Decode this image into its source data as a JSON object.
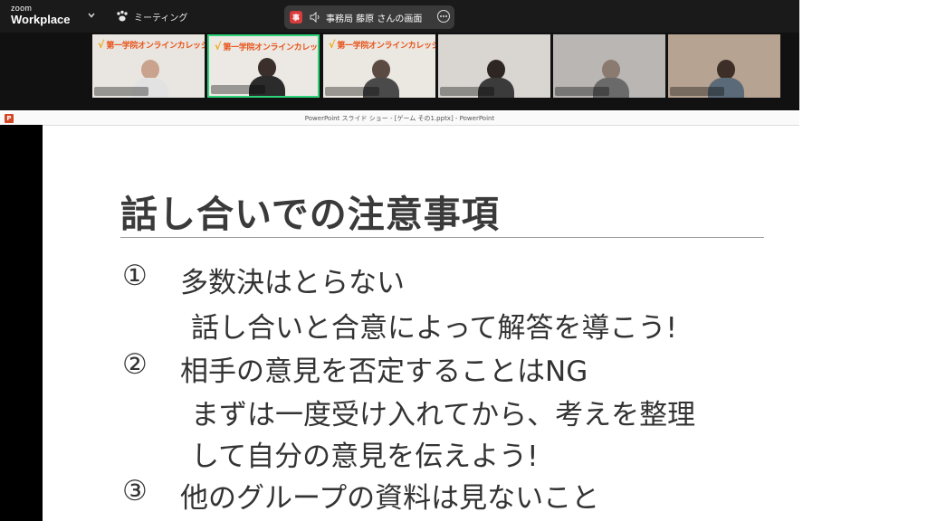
{
  "app": {
    "brand_small": "zoom",
    "brand_main": "Workplace",
    "meeting_label": "ミーティング",
    "share_badge": "事",
    "share_text": "事務局 藤原 さんの画面",
    "colors": {
      "active_border": "#2fd37a",
      "share_badge": "#d83b3b",
      "logo_orange": "#e8541a"
    }
  },
  "video_tiles": [
    {
      "logo_text": "第一学院オンラインカレッジ",
      "active": false
    },
    {
      "logo_text": "第一学院オンラインカレッジ",
      "active": true
    },
    {
      "logo_text": "第一学院オンラインカレッジ",
      "active": false
    },
    {
      "logo_text": "",
      "active": false
    },
    {
      "logo_text": "",
      "active": false
    },
    {
      "logo_text": "",
      "active": false
    }
  ],
  "ppt": {
    "window_title": "PowerPoint スライド ショー - [ゲーム その1.pptx] - PowerPoint",
    "app_icon": "powerpoint-icon"
  },
  "slide": {
    "title": "話し合いでの注意事項",
    "items": [
      {
        "num": "①",
        "lines": [
          "多数決はとらない",
          "話し合いと合意によって解答を導こう!"
        ]
      },
      {
        "num": "②",
        "lines": [
          "相手の意見を否定することはNG",
          "まずは一度受け入れてから、考えを整理",
          "して自分の意見を伝えよう!"
        ]
      },
      {
        "num": "③",
        "lines": [
          "他のグループの資料は見ないこと"
        ]
      }
    ]
  }
}
